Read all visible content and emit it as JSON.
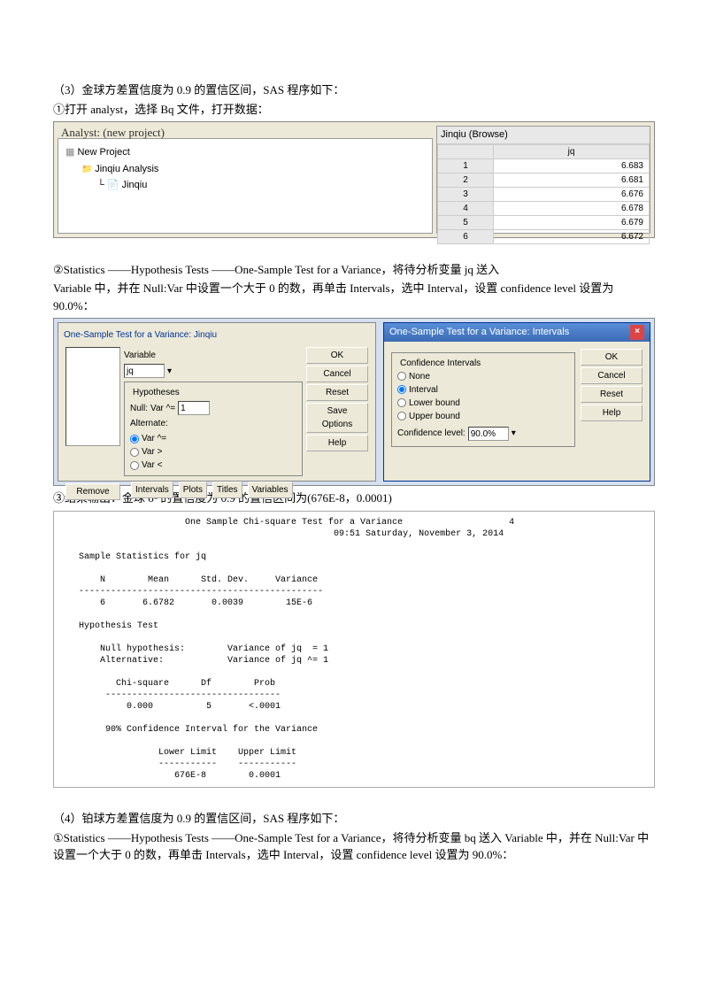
{
  "p1": "（3）金球方差置信度为 0.9 的置信区间，SAS 程序如下：",
  "p2": "①打开 analyst，选择 Bq 文件，打开数据：",
  "analyst": {
    "winTitle": "Analyst: (new project)",
    "proj": "New Project",
    "folder": "Jinqiu Analysis",
    "file": "Jinqiu",
    "browseTitle": "Jinqiu (Browse)",
    "colHeader": "jq",
    "rows": [
      [
        "1",
        "6.683"
      ],
      [
        "2",
        "6.681"
      ],
      [
        "3",
        "6.676"
      ],
      [
        "4",
        "6.678"
      ],
      [
        "5",
        "6.679"
      ],
      [
        "6",
        "6.672"
      ]
    ]
  },
  "p3": "②Statistics ——Hypothesis Tests ——One-Sample Test for a Variance，将待分析变量 jq 送入",
  "p4": "Variable 中，并在 Null:Var 中设置一个大于 0 的数，再单击 Intervals，选中 Interval，设置 confidence level 设置为 90.0%：",
  "dlg1": {
    "title": "One-Sample Test for a Variance: Jinqiu",
    "varLabel": "Variable",
    "varValue": "jq",
    "hypLabel": "Hypotheses",
    "nullLabel": "Null:",
    "nullField": "Var ^=",
    "nullVal": "1",
    "altLabel": "Alternate:",
    "alt1": "Var ^=",
    "alt2": "Var >",
    "alt3": "Var <",
    "btns": [
      "OK",
      "Cancel",
      "Reset",
      "Save Options",
      "Help"
    ],
    "remove": "Remove",
    "bottom": [
      "Intervals",
      "Plots",
      "Titles",
      "Variables"
    ]
  },
  "dlg2": {
    "title": "One-Sample Test for a Variance: Intervals",
    "groupTitle": "Confidence Intervals",
    "opts": [
      "None",
      "Interval",
      "Lower bound",
      "Upper bound"
    ],
    "confLabel": "Confidence level:",
    "confVal": "90.0%",
    "btns": [
      "OK",
      "Cancel",
      "Reset",
      "Help"
    ]
  },
  "p5": "③结果输出：金球 σ² 的置信度为 0.9 的置信区间为(676E-8，0.0001)",
  "output": "                       One Sample Chi-square Test for a Variance                    4\n                                                   09:51 Saturday, November 3, 2014\n\n   Sample Statistics for jq\n\n       N        Mean      Std. Dev.     Variance\n   ----------------------------------------------\n       6       6.6782       0.0039        15E-6\n\n   Hypothesis Test\n\n       Null hypothesis:        Variance of jq  = 1\n       Alternative:            Variance of jq ^= 1\n\n          Chi-square      Df        Prob\n        ---------------------------------\n            0.000          5       <.0001\n\n        90% Confidence Interval for the Variance\n\n                  Lower Limit    Upper Limit\n                  -----------    -----------\n                     676E-8        0.0001",
  "p6": "（4）铂球方差置信度为 0.9 的置信区间，SAS 程序如下：",
  "p7": "①Statistics ——Hypothesis Tests ——One-Sample Test for a Variance，将待分析变量 bq 送入 Variable 中，并在 Null:Var 中设置一个大于 0 的数，再单击 Intervals，选中 Interval，设置 confidence level 设置为 90.0%："
}
